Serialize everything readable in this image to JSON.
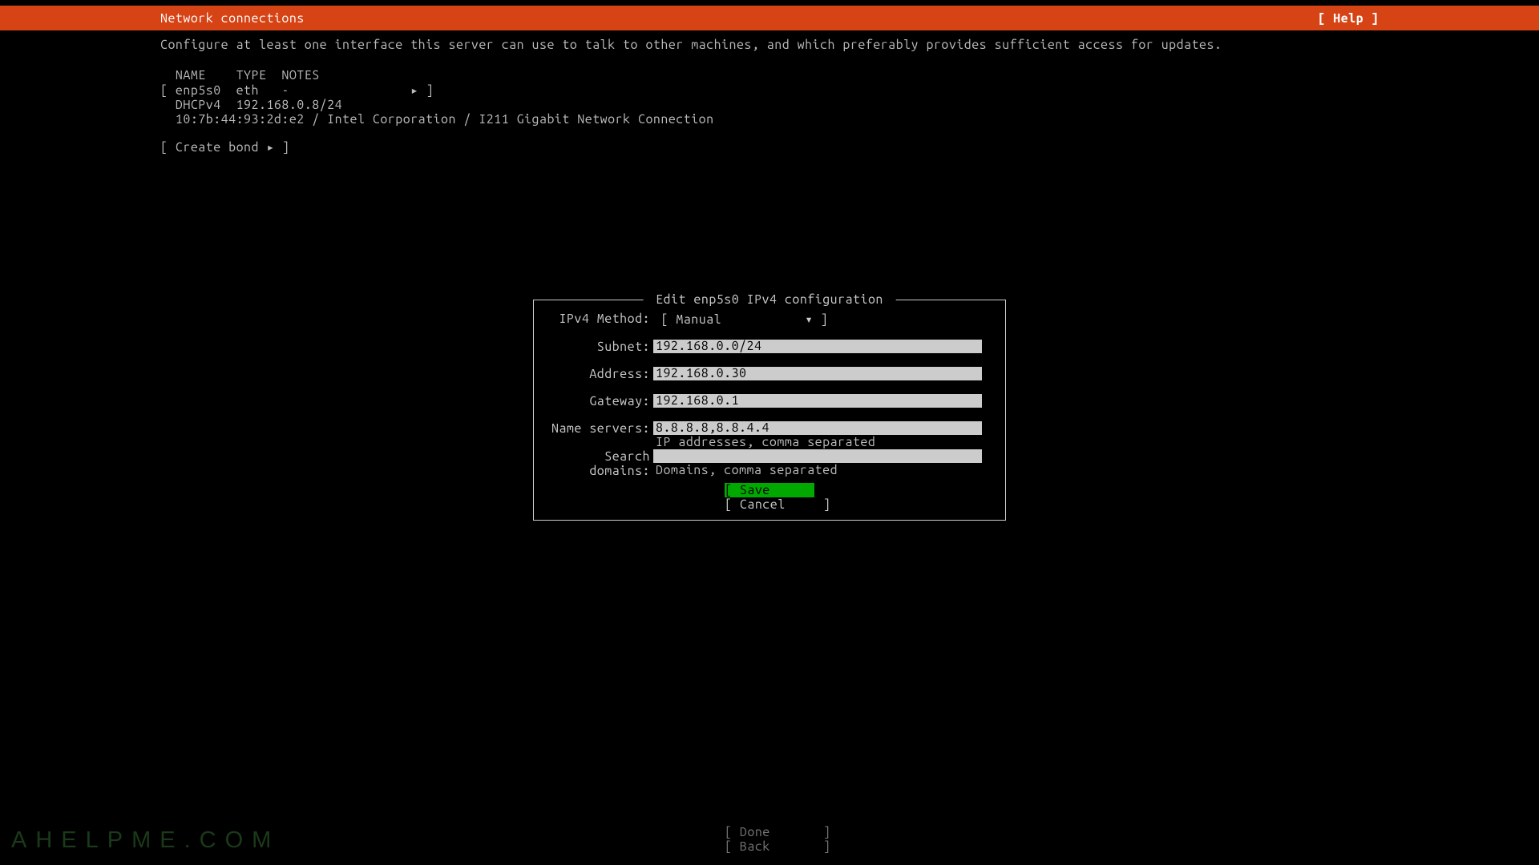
{
  "header": {
    "title": "Network connections",
    "help": "[ Help ]"
  },
  "desc": "Configure at least one interface this server can use to talk to other machines, and which preferably provides sufficient access for updates.",
  "table": {
    "head": "  NAME    TYPE  NOTES",
    "row1": "[ enp5s0  eth   -                ▸ ]",
    "row2": "  DHCPv4  192.168.0.8/24",
    "row3": "  10:7b:44:93:2d:e2 / Intel Corporation / I211 Gigabit Network Connection"
  },
  "create": "[ Create bond ▸ ]",
  "dialog": {
    "title": " Edit enp5s0 IPv4 configuration ",
    "method_label": "IPv4 Method:",
    "method_value": " [ Manual           ▾ ]",
    "subnet_label": "Subnet:",
    "subnet_value": "192.168.0.0/24",
    "address_label": "Address:",
    "address_value": "192.168.0.30",
    "gateway_label": "Gateway:",
    "gateway_value": "192.168.0.1",
    "ns_label": "Name servers:",
    "ns_value": "8.8.8.8,8.8.4.4",
    "ns_hint": "IP addresses, comma separated",
    "sd_label": "Search domains:",
    "sd_value": "",
    "sd_hint": "Domains, comma separated",
    "save": "[ Save       ]",
    "cancel": "[ Cancel     ]"
  },
  "footer": {
    "done": "[ Done       ]",
    "back": "[ Back       ]"
  },
  "watermark": "AHELPME.COM"
}
